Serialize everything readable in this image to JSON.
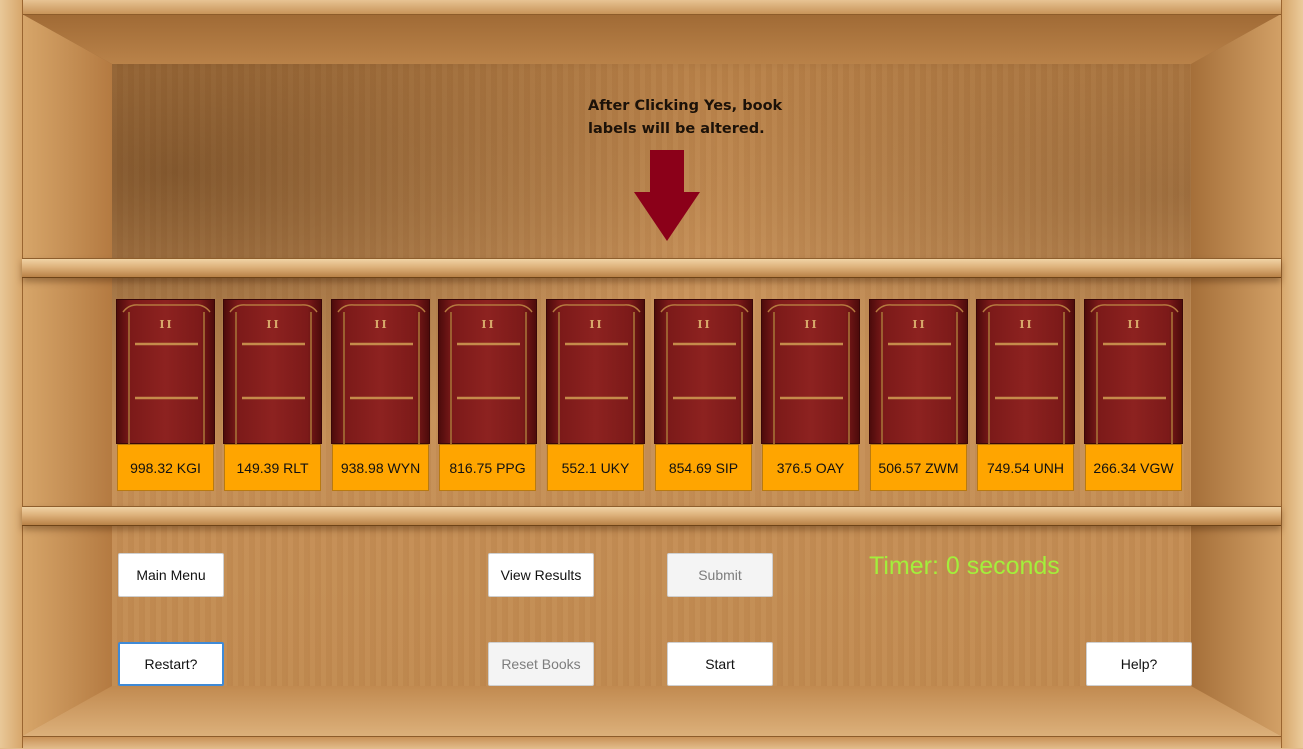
{
  "hint": {
    "line1": "After Clicking Yes, book",
    "line2": "labels will be altered."
  },
  "colors": {
    "arrow": "#8b0019",
    "label_bg": "#ffa500",
    "book_cover": "#7c1a19",
    "timer_text": "#a3ef3b"
  },
  "books": [
    {
      "numeral": "II",
      "label": "998.32 KGI"
    },
    {
      "numeral": "II",
      "label": "149.39 RLT"
    },
    {
      "numeral": "II",
      "label": "938.98 WYN"
    },
    {
      "numeral": "II",
      "label": "816.75 PPG"
    },
    {
      "numeral": "II",
      "label": "552.1 UKY"
    },
    {
      "numeral": "II",
      "label": "854.69 SIP"
    },
    {
      "numeral": "II",
      "label": "376.5 OAY"
    },
    {
      "numeral": "II",
      "label": "506.57 ZWM"
    },
    {
      "numeral": "II",
      "label": "749.54 UNH"
    },
    {
      "numeral": "II",
      "label": "266.34 VGW"
    }
  ],
  "buttons": {
    "main_menu": "Main Menu",
    "view_results": "View Results",
    "submit": "Submit",
    "restart": "Restart?",
    "reset_books": "Reset Books",
    "start": "Start",
    "help": "Help?"
  },
  "timer": "Timer: 0 seconds"
}
